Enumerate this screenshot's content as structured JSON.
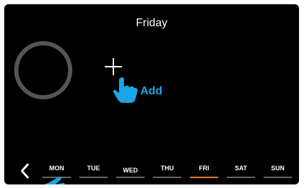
{
  "header": {
    "day_title": "Friday"
  },
  "add": {
    "label": "Add"
  },
  "week": {
    "days": [
      {
        "label": "MON"
      },
      {
        "label": "TUE"
      },
      {
        "label": "WED"
      },
      {
        "label": "THU"
      },
      {
        "label": "FRI"
      },
      {
        "label": "SAT"
      },
      {
        "label": "SUN"
      }
    ],
    "selected": "FRI"
  },
  "colors": {
    "accent": "#1aa6e6",
    "selected_underline": "#e07a2a",
    "ring": "#555555",
    "background": "#000000"
  },
  "icons": {
    "back": "chevron-left-icon",
    "add": "plus-icon",
    "pointer": "hand-pointer-icon",
    "progress": "ring-icon"
  }
}
